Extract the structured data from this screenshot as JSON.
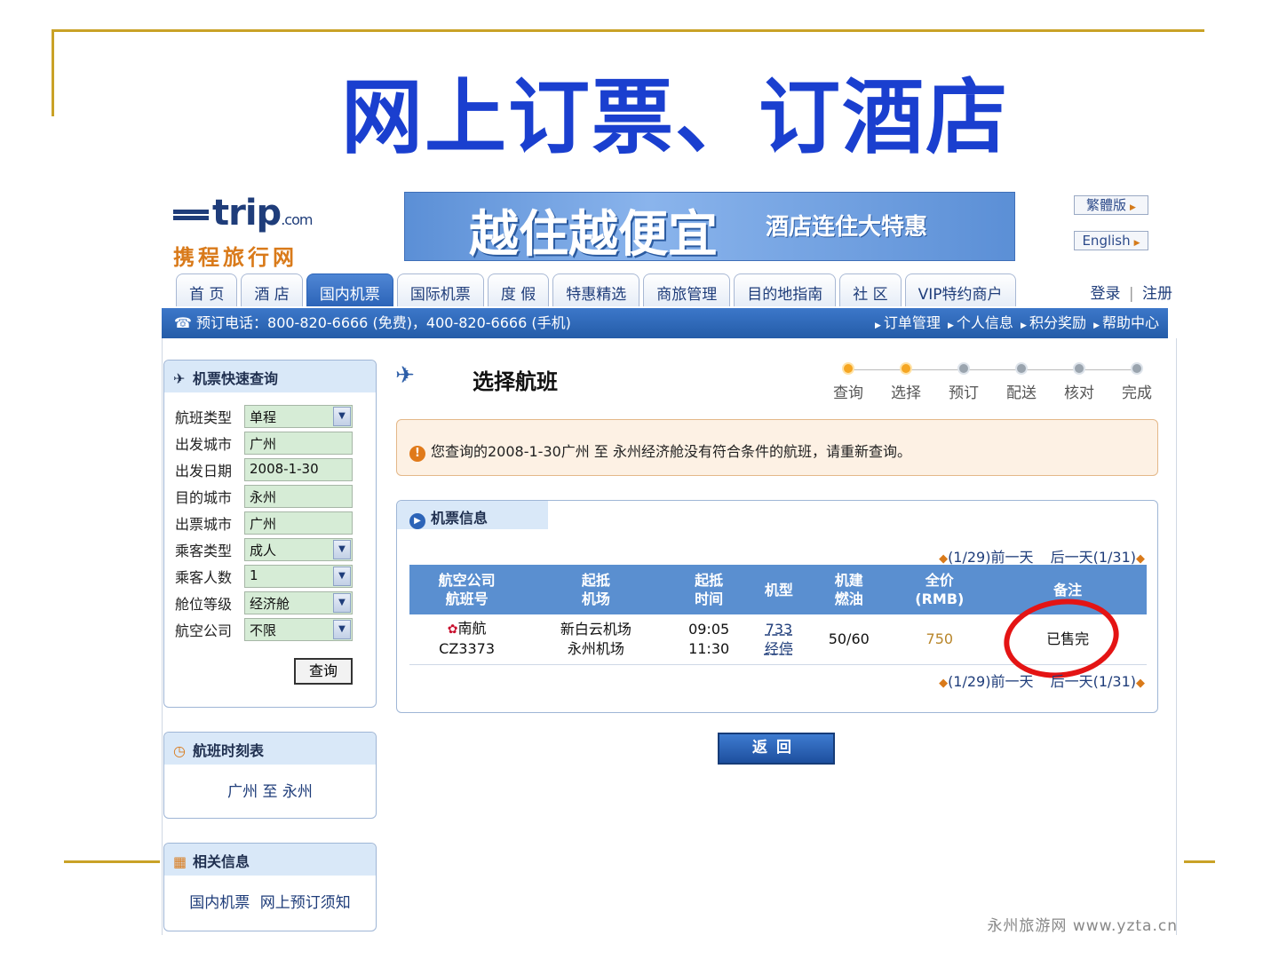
{
  "slide": {
    "title": "网上订票、订酒店"
  },
  "logo": {
    "brand": "trip",
    "com": ".com",
    "sub": "携程旅行网"
  },
  "banner": {
    "big_text": "越住越便宜",
    "small_text": "酒店连住大特惠"
  },
  "lang": {
    "traditional": "繁體版",
    "english": "English"
  },
  "nav": {
    "tabs": [
      "首 页",
      "酒 店",
      "国内机票",
      "国际机票",
      "度 假",
      "特惠精选",
      "商旅管理",
      "目的地指南",
      "社 区",
      "VIP特约商户"
    ],
    "active_index": 2,
    "login": "登录",
    "separator": "|",
    "register": "注册"
  },
  "infobar": {
    "phone": "☎ 预订电话：800-820-6666 (免费)，400-820-6666 (手机)",
    "links": [
      "订单管理",
      "个人信息",
      "积分奖励",
      "帮助中心"
    ]
  },
  "quick_search": {
    "title": "机票快速查询",
    "fields": [
      {
        "label": "航班类型",
        "value": "单程",
        "dropdown": true
      },
      {
        "label": "出发城市",
        "value": "广州",
        "dropdown": false
      },
      {
        "label": "出发日期",
        "value": "2008-1-30",
        "dropdown": false
      },
      {
        "label": "目的城市",
        "value": "永州",
        "dropdown": false
      },
      {
        "label": "出票城市",
        "value": "广州",
        "dropdown": false
      },
      {
        "label": "乘客类型",
        "value": "成人",
        "dropdown": true
      },
      {
        "label": "乘客人数",
        "value": "1",
        "dropdown": true
      },
      {
        "label": "舱位等级",
        "value": "经济舱",
        "dropdown": true
      },
      {
        "label": "航空公司",
        "value": "不限",
        "dropdown": true
      }
    ],
    "button": "查询"
  },
  "timetable": {
    "title": "航班时刻表",
    "link": "广州 至 永州"
  },
  "related": {
    "title": "相关信息",
    "links": [
      "国内机票",
      "网上预订须知"
    ]
  },
  "main": {
    "title": "选择航班",
    "steps": [
      {
        "label": "查询",
        "done": true
      },
      {
        "label": "选择",
        "done": true
      },
      {
        "label": "预订",
        "done": false
      },
      {
        "label": "配送",
        "done": false
      },
      {
        "label": "核对",
        "done": false
      },
      {
        "label": "完成",
        "done": false
      }
    ],
    "alert": "您查询的2008-1-30广州 至 永州经济舱没有符合条件的航班，请重新查询。",
    "ticket_title": "机票信息",
    "prev_day": "(1/29)前一天",
    "next_day": "后一天(1/31)",
    "columns": [
      [
        "航空公司",
        "航班号"
      ],
      [
        "起抵",
        "机场"
      ],
      [
        "起抵",
        "时间"
      ],
      [
        "机型"
      ],
      [
        "机建",
        "燃油"
      ],
      [
        "全价",
        "(RMB)"
      ],
      [
        "备注"
      ]
    ],
    "rows": [
      {
        "airline": "南航",
        "flight_no": "CZ3373",
        "dep_airport": "新白云机场",
        "arr_airport": "永州机场",
        "dep_time": "09:05",
        "arr_time": "11:30",
        "plane": "733",
        "stop": "经停",
        "tax": "50/60",
        "price": "750",
        "remark": "已售完"
      }
    ],
    "back_button": "返回"
  },
  "watermark": "永州旅游网 www.yzta.cn",
  "colors": {
    "title_blue": "#1a3fcf",
    "accent_gold": "#c9a227",
    "nav_blue": "#2c64b8",
    "circle_red": "#e41414"
  }
}
